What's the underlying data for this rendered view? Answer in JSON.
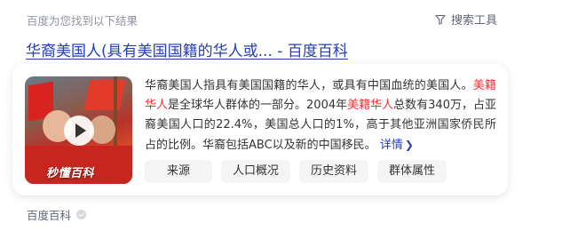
{
  "header": {
    "result_count": "百度为您找到以下结果",
    "search_tools": "搜索工具"
  },
  "result": {
    "title": "华裔美国人(具有美国国籍的华人或... - 百度百科",
    "thumbnail": {
      "watermark": "秒懂百科"
    },
    "description": {
      "seg1": "华裔美国人指具有美国国籍的华人，或具有中国血统的美国人。",
      "hl1": "美籍华人",
      "seg2": "是全球华人群体的一部分。2004年",
      "hl2": "美籍华人",
      "seg3": "总数有340万，占亚裔美国人口的22.4%，美国总人口的1%，高于其他亚洲国家侨民所占的比例。华裔包括ABC以及新的中国移民。",
      "more": "详情"
    },
    "tags": [
      "来源",
      "人口概况",
      "历史资料",
      "群体属性"
    ],
    "source": "百度百科"
  },
  "colors": {
    "link": "#2440b3",
    "highlight": "#f73131",
    "muted": "#9195a3"
  }
}
